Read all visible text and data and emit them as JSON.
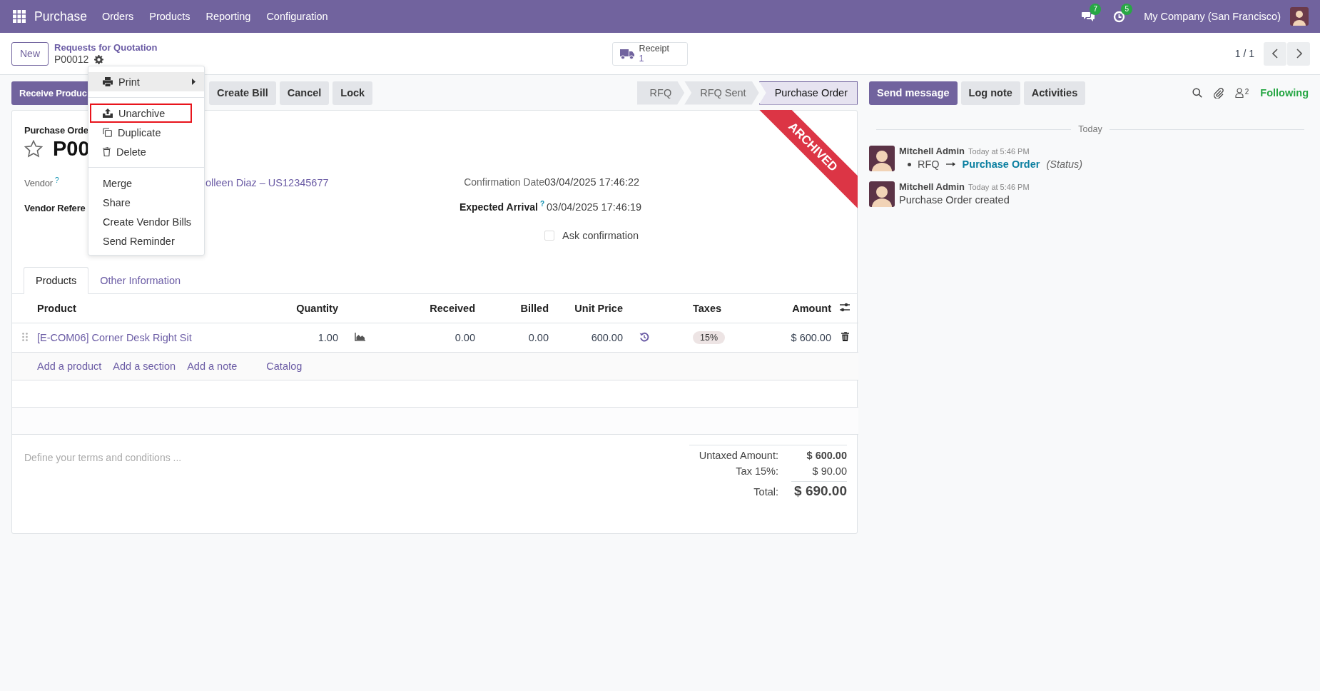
{
  "navbar": {
    "app": "Purchase",
    "menu": [
      "Orders",
      "Products",
      "Reporting",
      "Configuration"
    ],
    "messages_badge": "7",
    "activities_badge": "5",
    "company": "My Company (San Francisco)"
  },
  "control_panel": {
    "new_button": "New",
    "breadcrumb": "Requests for Quotation",
    "record": "P00012",
    "smart_button": {
      "label": "Receipt",
      "count": "1"
    },
    "pager": "1 / 1"
  },
  "actions": [
    {
      "label": "Receive Produc",
      "primary": true
    },
    {
      "label": "Create Bill",
      "primary": false
    },
    {
      "label": "Cancel",
      "primary": false
    },
    {
      "label": "Lock",
      "primary": false
    }
  ],
  "statusbar": [
    {
      "label": "RFQ",
      "selected": false
    },
    {
      "label": "RFQ Sent",
      "selected": false
    },
    {
      "label": "Purchase Order",
      "selected": true
    }
  ],
  "action_menu": {
    "groups": [
      [
        {
          "label": "Print",
          "kind": "print",
          "active": true,
          "highlighted": false
        }
      ],
      [
        {
          "label": "Unarchive",
          "kind": "unarchive",
          "active": false,
          "highlighted": true
        },
        {
          "label": "Duplicate",
          "kind": "duplicate",
          "active": false,
          "highlighted": false
        },
        {
          "label": "Delete",
          "kind": "delete",
          "active": false,
          "highlighted": false
        }
      ],
      [
        {
          "label": "Merge",
          "kind": "plain",
          "active": false,
          "highlighted": false
        },
        {
          "label": "Share",
          "kind": "plain",
          "active": false,
          "highlighted": false
        },
        {
          "label": "Create Vendor Bills",
          "kind": "plain",
          "active": false,
          "highlighted": false
        },
        {
          "label": "Send Reminder",
          "kind": "plain",
          "active": false,
          "highlighted": false
        }
      ]
    ]
  },
  "form": {
    "label": "Purchase Orde",
    "title": "P00",
    "starred": false,
    "ribbon": "ARCHIVED",
    "fields_left": [
      {
        "label": "Vendor",
        "help": "?",
        "value": "olleen Diaz – US12345677",
        "kind": "link",
        "emphasized": false
      },
      {
        "label": "Vendor Refere",
        "kind": "empty",
        "emphasized": true
      }
    ],
    "fields_right": [
      {
        "label": "Confirmation Date",
        "value": "03/04/2025 17:46:22",
        "kind": "text",
        "emphasized": false
      },
      {
        "label": "Expected Arrival",
        "help": "?",
        "value": "03/04/2025 17:46:19",
        "kind": "text",
        "emphasized": true
      }
    ],
    "checkbox": {
      "label": "Ask confirmation",
      "checked": false
    }
  },
  "tabs": [
    {
      "label": "Products",
      "selected": true
    },
    {
      "label": "Other Information",
      "selected": false
    }
  ],
  "table": {
    "columns": [
      "Product",
      "Quantity",
      "Received",
      "Billed",
      "Unit Price",
      "Taxes",
      "Amount"
    ],
    "rows": [
      {
        "product": "[E-COM06] Corner Desk Right Sit",
        "quantity": "1.00",
        "received": "0.00",
        "billed": "0.00",
        "unit_price": "600.00",
        "tax": "15%",
        "amount": "$ 600.00"
      }
    ],
    "add_links": [
      "Add a product",
      "Add a section",
      "Add a note",
      "Catalog"
    ]
  },
  "terms": {
    "placeholder": "Define your terms and conditions ..."
  },
  "totals": [
    {
      "label": "Untaxed Amount:",
      "value": "$ 600.00",
      "kind": "subtotal"
    },
    {
      "label": "Tax 15%:",
      "value": "$ 90.00",
      "kind": "tax"
    },
    {
      "label": "Total:",
      "value": "$ 690.00",
      "kind": "total"
    }
  ],
  "chatter": {
    "buttons": [
      {
        "label": "Send message",
        "primary": true
      },
      {
        "label": "Log note",
        "primary": false
      },
      {
        "label": "Activities",
        "primary": false
      }
    ],
    "followers": "2",
    "follow_label": "Following",
    "divider": "Today",
    "messages": [
      {
        "author": "Mitchell Admin",
        "time": "Today at 5:46 PM",
        "kind": "tracking",
        "from": "RFQ",
        "to": "Purchase Order",
        "field": "(Status)"
      },
      {
        "author": "Mitchell Admin",
        "time": "Today at 5:46 PM",
        "kind": "text",
        "body": "Purchase Order created"
      }
    ]
  }
}
